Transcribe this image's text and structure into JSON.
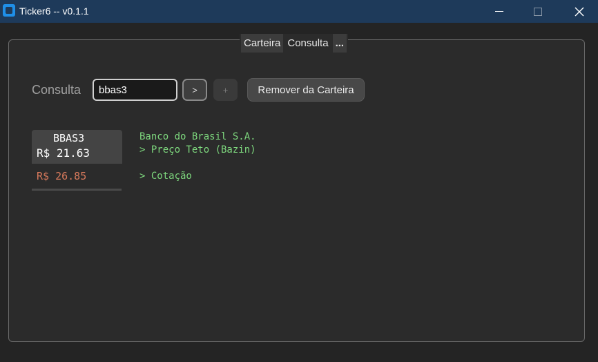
{
  "window": {
    "title": "Ticker6 -- v0.1.1"
  },
  "tabs": [
    {
      "label": "Carteira"
    },
    {
      "label": "Consulta"
    },
    {
      "label": "..."
    }
  ],
  "search": {
    "label": "Consulta",
    "value": "bbas3",
    "go_label": ">",
    "add_label": "+",
    "remove_label": "Remover da Carteira"
  },
  "stock": {
    "ticker": "BBAS3",
    "price": "R$ 21.63",
    "target_price": "R$ 26.85",
    "company": "Banco do Brasil S.A.",
    "teto_line": "> Preço Teto (Bazin)",
    "cotacao_line": "> Cotação"
  },
  "colors": {
    "titlebar": "#1e3a5a",
    "target_price": "#d87a5c",
    "info_text": "#7ed87e"
  }
}
